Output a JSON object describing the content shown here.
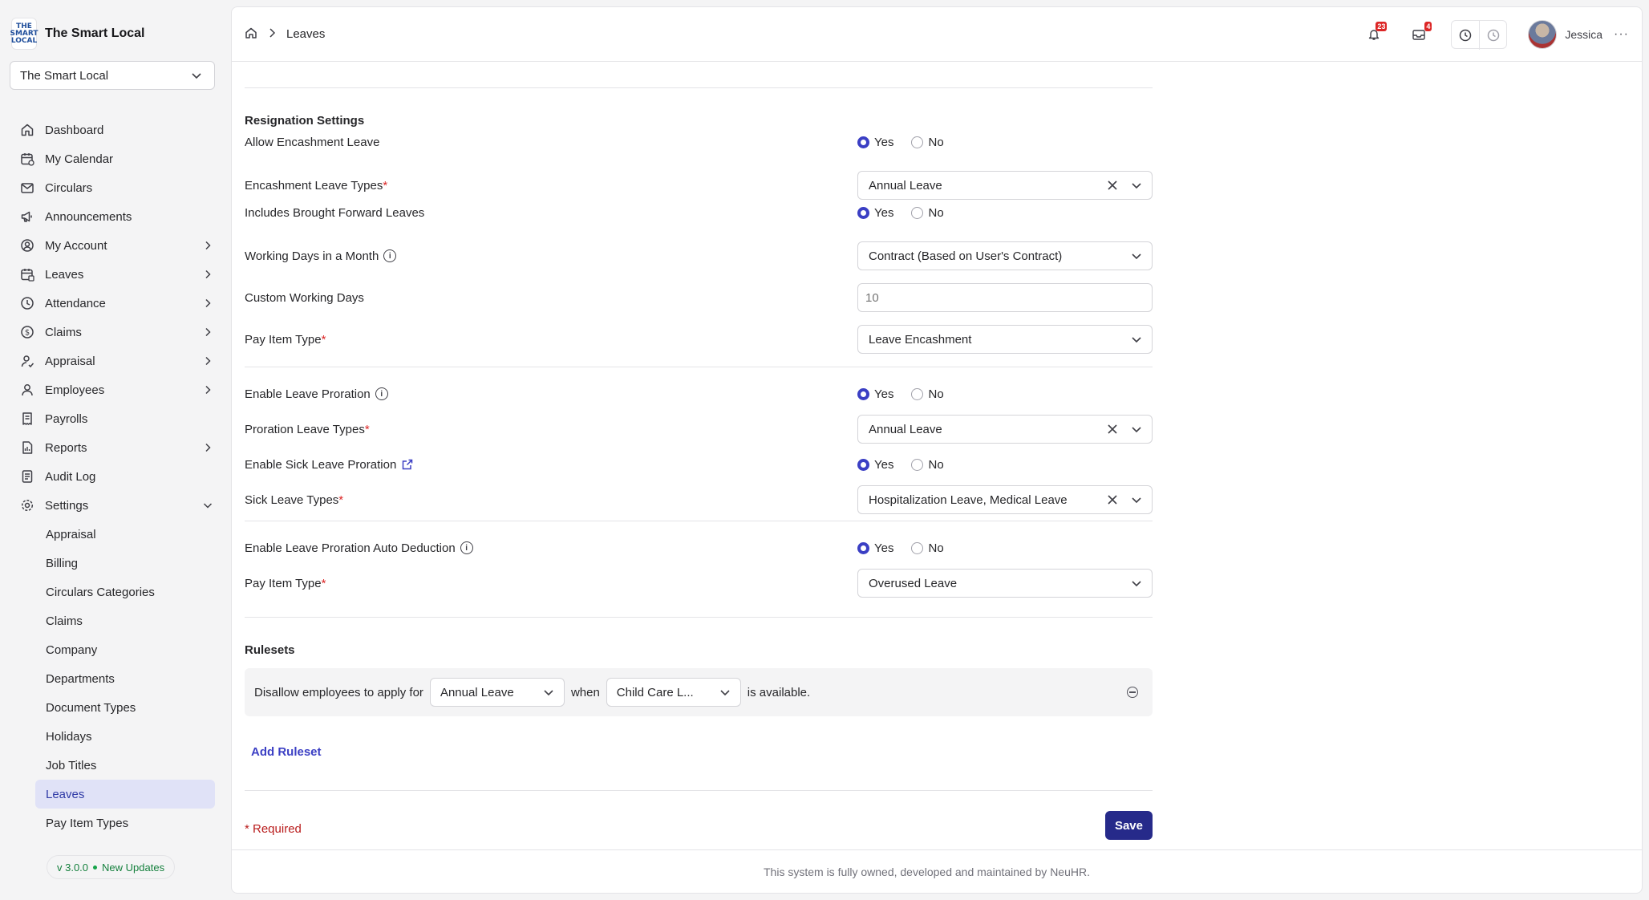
{
  "brand": {
    "name": "The Smart Local",
    "logo_text": "THE SMART LOCAL"
  },
  "company_select": {
    "value": "The Smart Local"
  },
  "nav": [
    {
      "label": "Dashboard",
      "icon": "home-icon",
      "chevron": false
    },
    {
      "label": "My Calendar",
      "icon": "calendar-icon",
      "chevron": false
    },
    {
      "label": "Circulars",
      "icon": "mail-icon",
      "chevron": false
    },
    {
      "label": "Announcements",
      "icon": "megaphone-icon",
      "chevron": false
    },
    {
      "label": "My Account",
      "icon": "user-circle-icon",
      "chevron": true
    },
    {
      "label": "Leaves",
      "icon": "calendar-leave-icon",
      "chevron": true
    },
    {
      "label": "Attendance",
      "icon": "clock-icon",
      "chevron": true
    },
    {
      "label": "Claims",
      "icon": "dollar-icon",
      "chevron": true
    },
    {
      "label": "Appraisal",
      "icon": "user-check-icon",
      "chevron": true
    },
    {
      "label": "Employees",
      "icon": "user-icon",
      "chevron": true
    },
    {
      "label": "Payrolls",
      "icon": "receipt-icon",
      "chevron": false
    },
    {
      "label": "Reports",
      "icon": "report-icon",
      "chevron": true
    },
    {
      "label": "Audit Log",
      "icon": "log-icon",
      "chevron": false
    },
    {
      "label": "Settings",
      "icon": "gear-icon",
      "chevron": true,
      "expanded": true
    }
  ],
  "settings_sub": [
    "Appraisal",
    "Billing",
    "Circulars Categories",
    "Claims",
    "Company",
    "Departments",
    "Document Types",
    "Holidays",
    "Job Titles",
    "Leaves",
    "Pay Item Types"
  ],
  "settings_sub_active": "Leaves",
  "version": {
    "number": "v 3.0.0",
    "updates": "New Updates"
  },
  "breadcrumb": {
    "current": "Leaves"
  },
  "header": {
    "notifications_count": "23",
    "inbox_count": "4",
    "user_name": "Jessica"
  },
  "colors": {
    "primary": "#3b3fc4",
    "save_button": "#262a8a",
    "active_nav_bg": "#e0e2f7",
    "required": "#dc2626"
  },
  "section": {
    "title": "Resignation Settings"
  },
  "fields": {
    "allow_encashment": {
      "label": "Allow Encashment Leave",
      "yes": "Yes",
      "no": "No",
      "value": "Yes"
    },
    "encashment_types": {
      "label": "Encashment Leave Types",
      "value": "Annual Leave"
    },
    "includes_bf": {
      "label": "Includes Brought Forward Leaves",
      "yes": "Yes",
      "no": "No",
      "value": "Yes"
    },
    "working_days": {
      "label": "Working Days in a Month",
      "value": "Contract (Based on User's Contract)"
    },
    "custom_working_days": {
      "label": "Custom Working Days",
      "placeholder": "10"
    },
    "pay_item_type_1": {
      "label": "Pay Item Type",
      "value": "Leave Encashment"
    },
    "enable_proration": {
      "label": "Enable Leave Proration",
      "yes": "Yes",
      "no": "No",
      "value": "Yes"
    },
    "proration_types": {
      "label": "Proration Leave Types",
      "value": "Annual Leave"
    },
    "sick_proration": {
      "label": "Enable Sick Leave Proration",
      "yes": "Yes",
      "no": "No",
      "value": "Yes"
    },
    "sick_types": {
      "label": "Sick Leave Types",
      "value": "Hospitalization Leave, Medical Leave"
    },
    "auto_deduction": {
      "label": "Enable Leave Proration Auto Deduction",
      "yes": "Yes",
      "no": "No",
      "value": "Yes"
    },
    "pay_item_type_2": {
      "label": "Pay Item Type",
      "value": "Overused Leave"
    }
  },
  "rulesets": {
    "title": "Rulesets",
    "rule": {
      "prefix": "Disallow employees to apply for",
      "leave": "Annual Leave",
      "when": "when",
      "condition": "Child Care L...",
      "suffix": "is available."
    },
    "add_label": "Add Ruleset"
  },
  "form": {
    "required_note": "* Required",
    "save_label": "Save"
  },
  "footer": {
    "text": "This system is fully owned, developed and maintained by NeuHR."
  }
}
